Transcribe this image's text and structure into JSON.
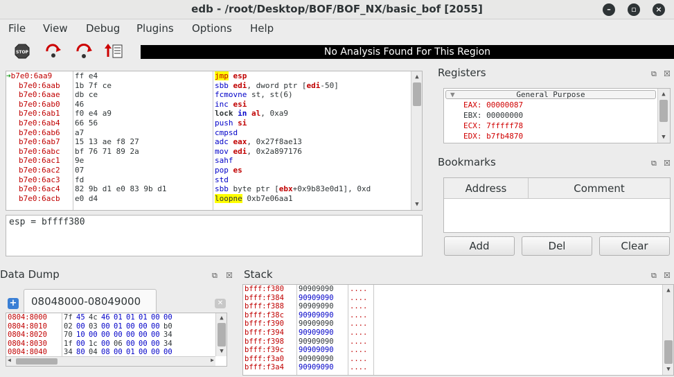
{
  "window": {
    "title": "edb - /root/Desktop/BOF/BOF_NX/basic_bof [2055]"
  },
  "menu": [
    "File",
    "View",
    "Debug",
    "Plugins",
    "Options",
    "Help"
  ],
  "toolbar": {
    "stop_label": "STOP",
    "analysis_text": "No Analysis Found For This Region"
  },
  "disasm": {
    "rows": [
      {
        "addr": "b7e0:6aa9",
        "bytes": "ff e4",
        "mn": "jmp",
        "ops": "esp",
        "current": true
      },
      {
        "addr": "b7e0:6aab",
        "bytes": "1b 7f ce",
        "mn": "sbb",
        "ops": "edi, dword ptr [edi-50]"
      },
      {
        "addr": "b7e0:6aae",
        "bytes": "db ce",
        "mn": "fcmovne",
        "ops": "st, st(6)"
      },
      {
        "addr": "b7e0:6ab0",
        "bytes": "46",
        "mn": "inc",
        "ops": "esi"
      },
      {
        "addr": "b7e0:6ab1",
        "bytes": "f0 e4 a9",
        "mn": "lock in",
        "ops": "al, 0xa9"
      },
      {
        "addr": "b7e0:6ab4",
        "bytes": "66 56",
        "mn": "push",
        "ops": "si"
      },
      {
        "addr": "b7e0:6ab6",
        "bytes": "a7",
        "mn": "cmpsd",
        "ops": ""
      },
      {
        "addr": "b7e0:6ab7",
        "bytes": "15 13 ae f8 27",
        "mn": "adc",
        "ops": "eax, 0x27f8ae13"
      },
      {
        "addr": "b7e0:6abc",
        "bytes": "bf 76 71 89 2a",
        "mn": "mov",
        "ops": "edi, 0x2a897176"
      },
      {
        "addr": "b7e0:6ac1",
        "bytes": "9e",
        "mn": "sahf",
        "ops": ""
      },
      {
        "addr": "b7e0:6ac2",
        "bytes": "07",
        "mn": "pop",
        "ops": "es"
      },
      {
        "addr": "b7e0:6ac3",
        "bytes": "fd",
        "mn": "std",
        "ops": ""
      },
      {
        "addr": "b7e0:6ac4",
        "bytes": "82 9b d1 e0 83 9b d1",
        "mn": "sbb",
        "ops": "byte ptr [ebx+0x9b83e0d1], 0xd"
      },
      {
        "addr": "b7e0:6acb",
        "bytes": "e0 d4",
        "mn": "loopne",
        "ops": "0xb7e06aa1"
      }
    ]
  },
  "expression": "esp = bffff380",
  "registers": {
    "title": "Registers",
    "group": "General Purpose",
    "rows": [
      {
        "name": "EAX",
        "value": "00000087",
        "changed": true
      },
      {
        "name": "EBX",
        "value": "00000000",
        "changed": false
      },
      {
        "name": "ECX",
        "value": "7fffff78",
        "changed": true
      },
      {
        "name": "EDX",
        "value": "b7fb4870",
        "changed": true
      }
    ]
  },
  "bookmarks": {
    "title": "Bookmarks",
    "col_address": "Address",
    "col_comment": "Comment",
    "add": "Add",
    "del": "Del",
    "clear": "Clear"
  },
  "dump": {
    "title": "Data Dump",
    "tab": "08048000-08049000",
    "rows": [
      {
        "addr": "0804:8000",
        "bytes": [
          "7f",
          "45",
          "4c",
          "46",
          "01",
          "01",
          "01",
          "00",
          "00"
        ]
      },
      {
        "addr": "0804:8010",
        "bytes": [
          "02",
          "00",
          "03",
          "00",
          "01",
          "00",
          "00",
          "00",
          "b0"
        ]
      },
      {
        "addr": "0804:8020",
        "bytes": [
          "70",
          "10",
          "00",
          "00",
          "00",
          "00",
          "00",
          "00",
          "34"
        ]
      },
      {
        "addr": "0804:8030",
        "bytes": [
          "1f",
          "00",
          "1c",
          "00",
          "06",
          "00",
          "00",
          "00",
          "34"
        ]
      },
      {
        "addr": "0804:8040",
        "bytes": [
          "34",
          "80",
          "04",
          "08",
          "00",
          "01",
          "00",
          "00",
          "00"
        ]
      }
    ]
  },
  "stack": {
    "title": "Stack",
    "rows": [
      {
        "addr": "bfff:f380",
        "value": "90909090",
        "ascii": "...."
      },
      {
        "addr": "bfff:f384",
        "value": "90909090",
        "ascii": "...."
      },
      {
        "addr": "bfff:f388",
        "value": "90909090",
        "ascii": "...."
      },
      {
        "addr": "bfff:f38c",
        "value": "90909090",
        "ascii": "...."
      },
      {
        "addr": "bfff:f390",
        "value": "90909090",
        "ascii": "...."
      },
      {
        "addr": "bfff:f394",
        "value": "90909090",
        "ascii": "...."
      },
      {
        "addr": "bfff:f398",
        "value": "90909090",
        "ascii": "...."
      },
      {
        "addr": "bfff:f39c",
        "value": "90909090",
        "ascii": "...."
      },
      {
        "addr": "bfff:f3a0",
        "value": "90909090",
        "ascii": "...."
      },
      {
        "addr": "bfff:f3a4",
        "value": "90909090",
        "ascii": "...."
      }
    ]
  }
}
